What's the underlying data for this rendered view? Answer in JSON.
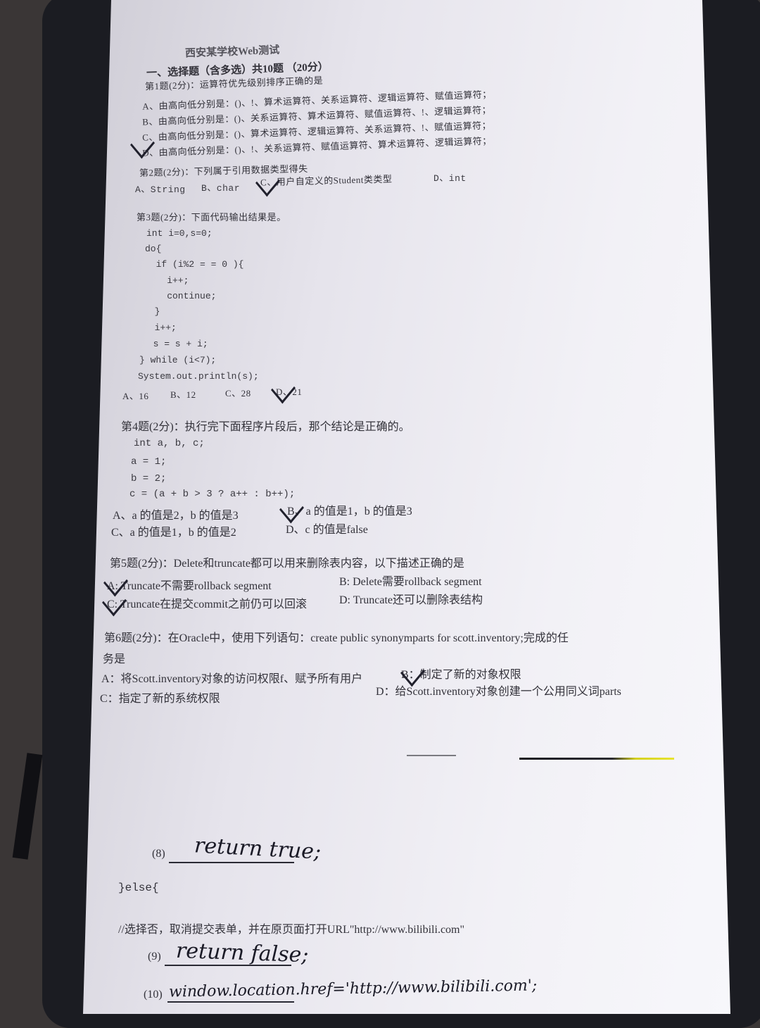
{
  "header": {
    "title": "西安某学校Web测试",
    "section": "一、选择题（含多选）共10题 （20分）"
  },
  "q1": {
    "stem": "第1题(2分)：运算符优先级别排序正确的是",
    "a": "A、由高向低分别是：()、!、算术运算符、关系运算符、逻辑运算符、赋值运算符；",
    "b": "B、由高向低分别是：()、关系运算符、算术运算符、赋值运算符、!、逻辑运算符；",
    "c": "C、由高向低分别是：()、算术运算符、逻辑运算符、关系运算符、!、赋值运算符；",
    "d": "D、由高向低分别是：()、!、关系运算符、赋值运算符、算术运算符、逻辑运算符；"
  },
  "q2": {
    "stem": "第2题(2分)：下列属于引用数据类型得失",
    "a": "A、String",
    "b": "B、char",
    "c": "C、用户自定义的Student类类型",
    "d": "D、int"
  },
  "q3": {
    "stem": "第3题(2分)：下面代码输出结果是。",
    "code": [
      "int i=0,s=0;",
      "do{",
      "  if (i%2 = = 0 ){",
      "    i++;",
      "    continue;",
      "  }",
      "  i++;",
      "  s = s + i;",
      "} while (i<7);",
      "System.out.println(s);"
    ],
    "a": "A、16",
    "b": "B、12",
    "c": "C、28",
    "d": "D、21"
  },
  "q4": {
    "stem": "第4题(2分)：执行完下面程序片段后，那个结论是正确的。",
    "code": [
      "int a, b, c;",
      "a = 1;",
      "b = 2;",
      "c = (a + b > 3 ? a++ : b++);"
    ],
    "a": "A、a 的值是2，b 的值是3",
    "b": "B、a 的值是1，b 的值是3",
    "c": "C、a 的值是1，b 的值是2",
    "d": "D、c 的值是false"
  },
  "q5": {
    "stem": "第5题(2分)：Delete和truncate都可以用来删除表内容，以下描述正确的是",
    "a": "A: Truncate不需要rollback segment",
    "b": "B: Delete需要rollback segment",
    "c": "C: Truncate在提交commit之前仍可以回滚",
    "d": "D: Truncate还可以删除表结构"
  },
  "q6": {
    "stem1": "第6题(2分)：在Oracle中，使用下列语句：create public synonymparts for scott.inventory;完成的任",
    "stem2": "务是",
    "a": "A：将Scott.inventory对象的访问权限f、赋予所有用户",
    "b": "B：制定了新的对象权限",
    "c": "C：指定了新的系统权限",
    "d": "D：给Scott.inventory对象创建一个公用同义词parts"
  },
  "answers": {
    "n8": "(8)",
    "a8": "return true;",
    "else_line": "}else{",
    "comment": "//选择否，取消提交表单，并在原页面打开URL\"http://www.bilibili.com\"",
    "n9": "(9)",
    "a9": "return false;",
    "n10": "(10)",
    "a10": "window.location.href='http://www.bilibili.com';"
  }
}
